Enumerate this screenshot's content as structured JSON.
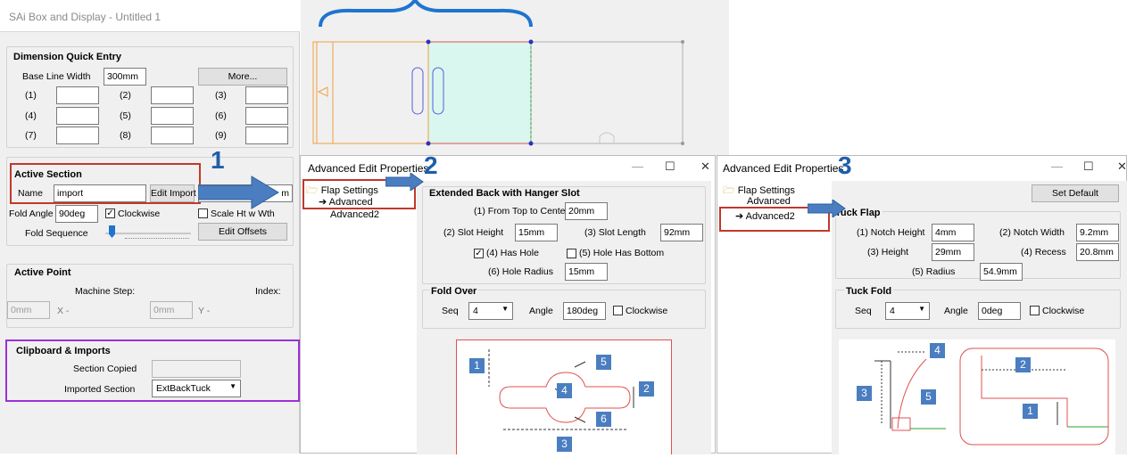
{
  "main_window": {
    "title": "SAi Box and Display - Untitled 1",
    "dimension_quick_entry": {
      "title": "Dimension Quick Entry",
      "base_line_width_label": "Base Line Width",
      "base_line_width_value": "300mm",
      "more_button": "More...",
      "field_labels": [
        "(1)",
        "(2)",
        "(3)",
        "(4)",
        "(5)",
        "(6)",
        "(7)",
        "(8)",
        "(9)"
      ]
    },
    "active_section": {
      "title": "Active Section",
      "name_label": "Name",
      "name_value": "import",
      "edit_import_button": "Edit Import",
      "hidden_value_tail": "m",
      "fold_angle_label": "Fold Angle",
      "fold_angle_value": "90deg",
      "clockwise_label": "Clockwise",
      "scale_label": "Scale Ht w Wth",
      "fold_sequence_label": "Fold Sequence",
      "edit_offsets_button": "Edit Offsets"
    },
    "active_point": {
      "title": "Active Point",
      "machine_step_label": "Machine Step:",
      "index_label": "Index:",
      "x_value": "0mm",
      "x_label": "X -",
      "y_value": "0mm",
      "y_label": "Y -"
    },
    "clipboard": {
      "title": "Clipboard & Imports",
      "section_copied_label": "Section Copied",
      "imported_section_label": "Imported Section",
      "imported_section_value": "ExtBackTuck"
    }
  },
  "callouts": {
    "one": "1",
    "two": "2",
    "three": "3"
  },
  "dialog2": {
    "title": "Advanced Edit Properties",
    "tree": {
      "root": "Flap Settings",
      "item1": "Advanced",
      "item2": "Advanced2"
    },
    "group1": {
      "title": "Extended Back with Hanger Slot",
      "from_top_label": "(1) From Top to Center",
      "from_top_value": "20mm",
      "slot_height_label": "(2) Slot Height",
      "slot_height_value": "15mm",
      "slot_length_label": "(3) Slot Length",
      "slot_length_value": "92mm",
      "has_hole_label": "(4) Has Hole",
      "has_hole_bottom_label": "(5) Hole Has Bottom",
      "hole_radius_label": "(6) Hole Radius",
      "hole_radius_value": "15mm"
    },
    "fold_over": {
      "title": "Fold Over",
      "seq_label": "Seq",
      "seq_value": "4",
      "angle_label": "Angle",
      "angle_value": "180deg",
      "clockwise_label": "Clockwise"
    },
    "diagram_badges": [
      "1",
      "2",
      "3",
      "4",
      "5",
      "6"
    ]
  },
  "dialog3": {
    "title": "Advanced Edit Properties",
    "tree": {
      "root": "Flap Settings",
      "item1": "Advanced",
      "item2": "Advanced2"
    },
    "set_default_button": "Set Default",
    "tuck_flap": {
      "title": "Tuck Flap",
      "notch_height_label": "(1) Notch Height",
      "notch_height_value": "4mm",
      "notch_width_label": "(2) Notch Width",
      "notch_width_value": "9.2mm",
      "height_label": "(3) Height",
      "height_value": "29mm",
      "recess_label": "(4) Recess",
      "recess_value": "20.8mm",
      "radius_label": "(5) Radius",
      "radius_value": "54.9mm"
    },
    "tuck_fold": {
      "title": "Tuck Fold",
      "seq_label": "Seq",
      "seq_value": "4",
      "angle_label": "Angle",
      "angle_value": "0deg",
      "clockwise_label": "Clockwise"
    },
    "diagram_badges": [
      "1",
      "2",
      "3",
      "4",
      "5"
    ]
  },
  "colors": {
    "accent_blue": "#1f5ea8",
    "highlight_red": "#c0392b",
    "highlight_purple": "#9b30d9",
    "flap_fill": "#d9f7ef"
  }
}
